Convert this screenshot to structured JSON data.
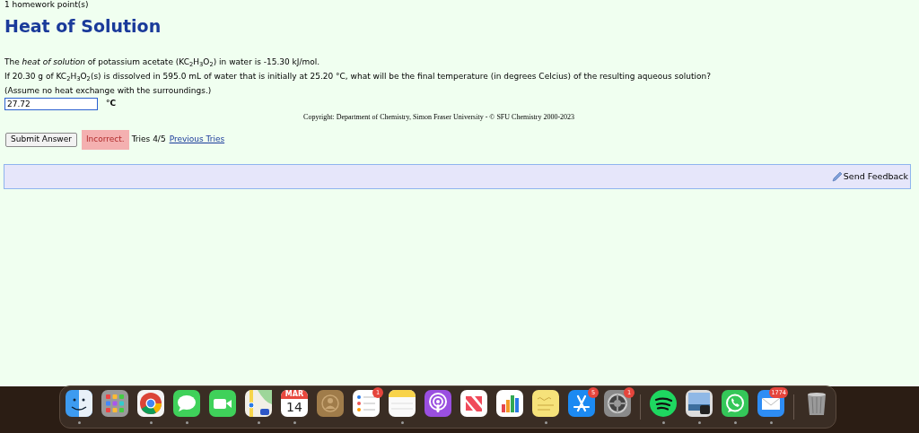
{
  "points": "1 homework point(s)",
  "title": "Heat of Solution",
  "question": [
    "The *heat of solution* of potassium acetate (KC$_{2}$H$_{3}$O$_{2}$) in water is -15.30 kJ/mol.",
    "If 20.30 g of KC$_{2}$H$_{3}$O$_{2}$(s) is dissolved in 595.0 mL of water that is initially at 25.20 °C, what will be the final temperature (in degrees Celcius) of the resulting aqueous solution?",
    "(Assume no heat exchange with the surroundings.)"
  ],
  "answer": {
    "value": "27.72",
    "unit": "°C"
  },
  "copyright": "Copyright: Department of Chemistry, Simon Fraser University - © SFU Chemistry 2000-2023",
  "submit": "Submit Answer",
  "result": {
    "text": "Incorrect.",
    "correct": false
  },
  "tries": "Tries 4/5",
  "previous_tries": "Previous Tries",
  "feedback": "Send Feedback",
  "dock": {
    "items": [
      {
        "kind": "finder",
        "running": true
      },
      {
        "kind": "launchpad",
        "running": false
      },
      {
        "kind": "chrome",
        "running": true
      },
      {
        "kind": "messages",
        "running": true
      },
      {
        "kind": "facetime",
        "running": false
      },
      {
        "kind": "maps",
        "running": true
      },
      {
        "kind": "calendar",
        "running": true,
        "month": "MAR",
        "day": "14"
      },
      {
        "kind": "contacts",
        "running": false
      },
      {
        "kind": "reminders",
        "running": false,
        "badge": "1"
      },
      {
        "kind": "notes",
        "running": true
      },
      {
        "kind": "podcasts",
        "running": false
      },
      {
        "kind": "news",
        "running": false
      },
      {
        "kind": "numbers",
        "running": false
      },
      {
        "kind": "stickies",
        "running": true
      },
      {
        "kind": "appstore",
        "running": false,
        "badge": "5"
      },
      {
        "kind": "settings",
        "running": false,
        "badge": "1"
      },
      {
        "kind": "separator"
      },
      {
        "kind": "spotify",
        "running": true
      },
      {
        "kind": "preview",
        "running": true
      },
      {
        "kind": "whatsapp",
        "running": true
      },
      {
        "kind": "mail",
        "running": true,
        "badge": "1774"
      },
      {
        "kind": "separator"
      },
      {
        "kind": "trash",
        "running": false
      }
    ]
  }
}
